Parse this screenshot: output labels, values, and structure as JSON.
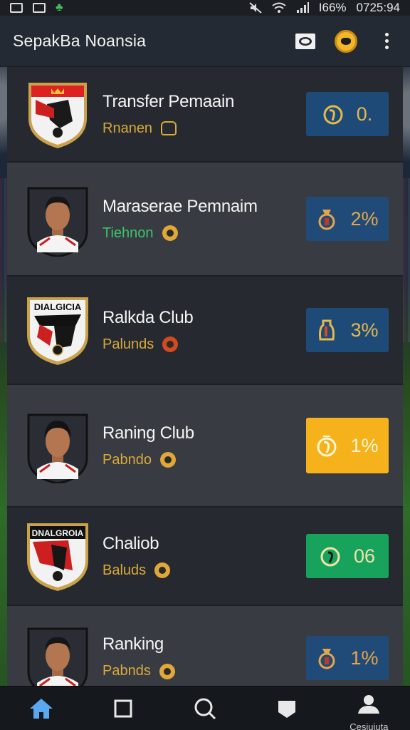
{
  "status_bar": {
    "battery": "I66%",
    "time": "0725:94"
  },
  "app_bar": {
    "title": "SepakBa Noansia",
    "icons": [
      "image-icon",
      "coin-icon",
      "more-vert-icon"
    ]
  },
  "list": [
    {
      "title": "Transfer Pemaain",
      "subtitle": "Rnanen",
      "subtitle_color": "gold",
      "badge_value": "0.",
      "badge_color": "#1e4a78",
      "emblem": "club-crest"
    },
    {
      "title": "Maraserae Pemnaim",
      "subtitle": "Tiehnon",
      "subtitle_color": "green",
      "badge_value": "2%",
      "badge_color": "#204a78",
      "emblem": "player-avatar"
    },
    {
      "title": "Ralkda Club",
      "subtitle": "Palunds",
      "subtitle_color": "gold",
      "badge_value": "3%",
      "badge_color": "#1e4a78",
      "emblem": "club-crest",
      "crest_text": "DIALGICIA"
    },
    {
      "title": "Raning Club",
      "subtitle": "Pabndo",
      "subtitle_color": "gold",
      "badge_value": "1%",
      "badge_color": "#f6b21a",
      "emblem": "player-avatar"
    },
    {
      "title": "Chaliob",
      "subtitle": "Baluds",
      "subtitle_color": "gold",
      "badge_value": "06",
      "badge_color": "#17a35c",
      "emblem": "club-crest",
      "crest_text": "DNALGROIA"
    },
    {
      "title": "Ranking",
      "subtitle": "Pabnds",
      "subtitle_color": "gold",
      "badge_value": "1%",
      "badge_color": "#204a78",
      "emblem": "player-avatar"
    }
  ],
  "bottom_nav": {
    "items": [
      "home-icon",
      "square-icon",
      "search-icon",
      "chat-icon",
      "profile-icon"
    ],
    "profile_label": "Cesiuiuta"
  }
}
